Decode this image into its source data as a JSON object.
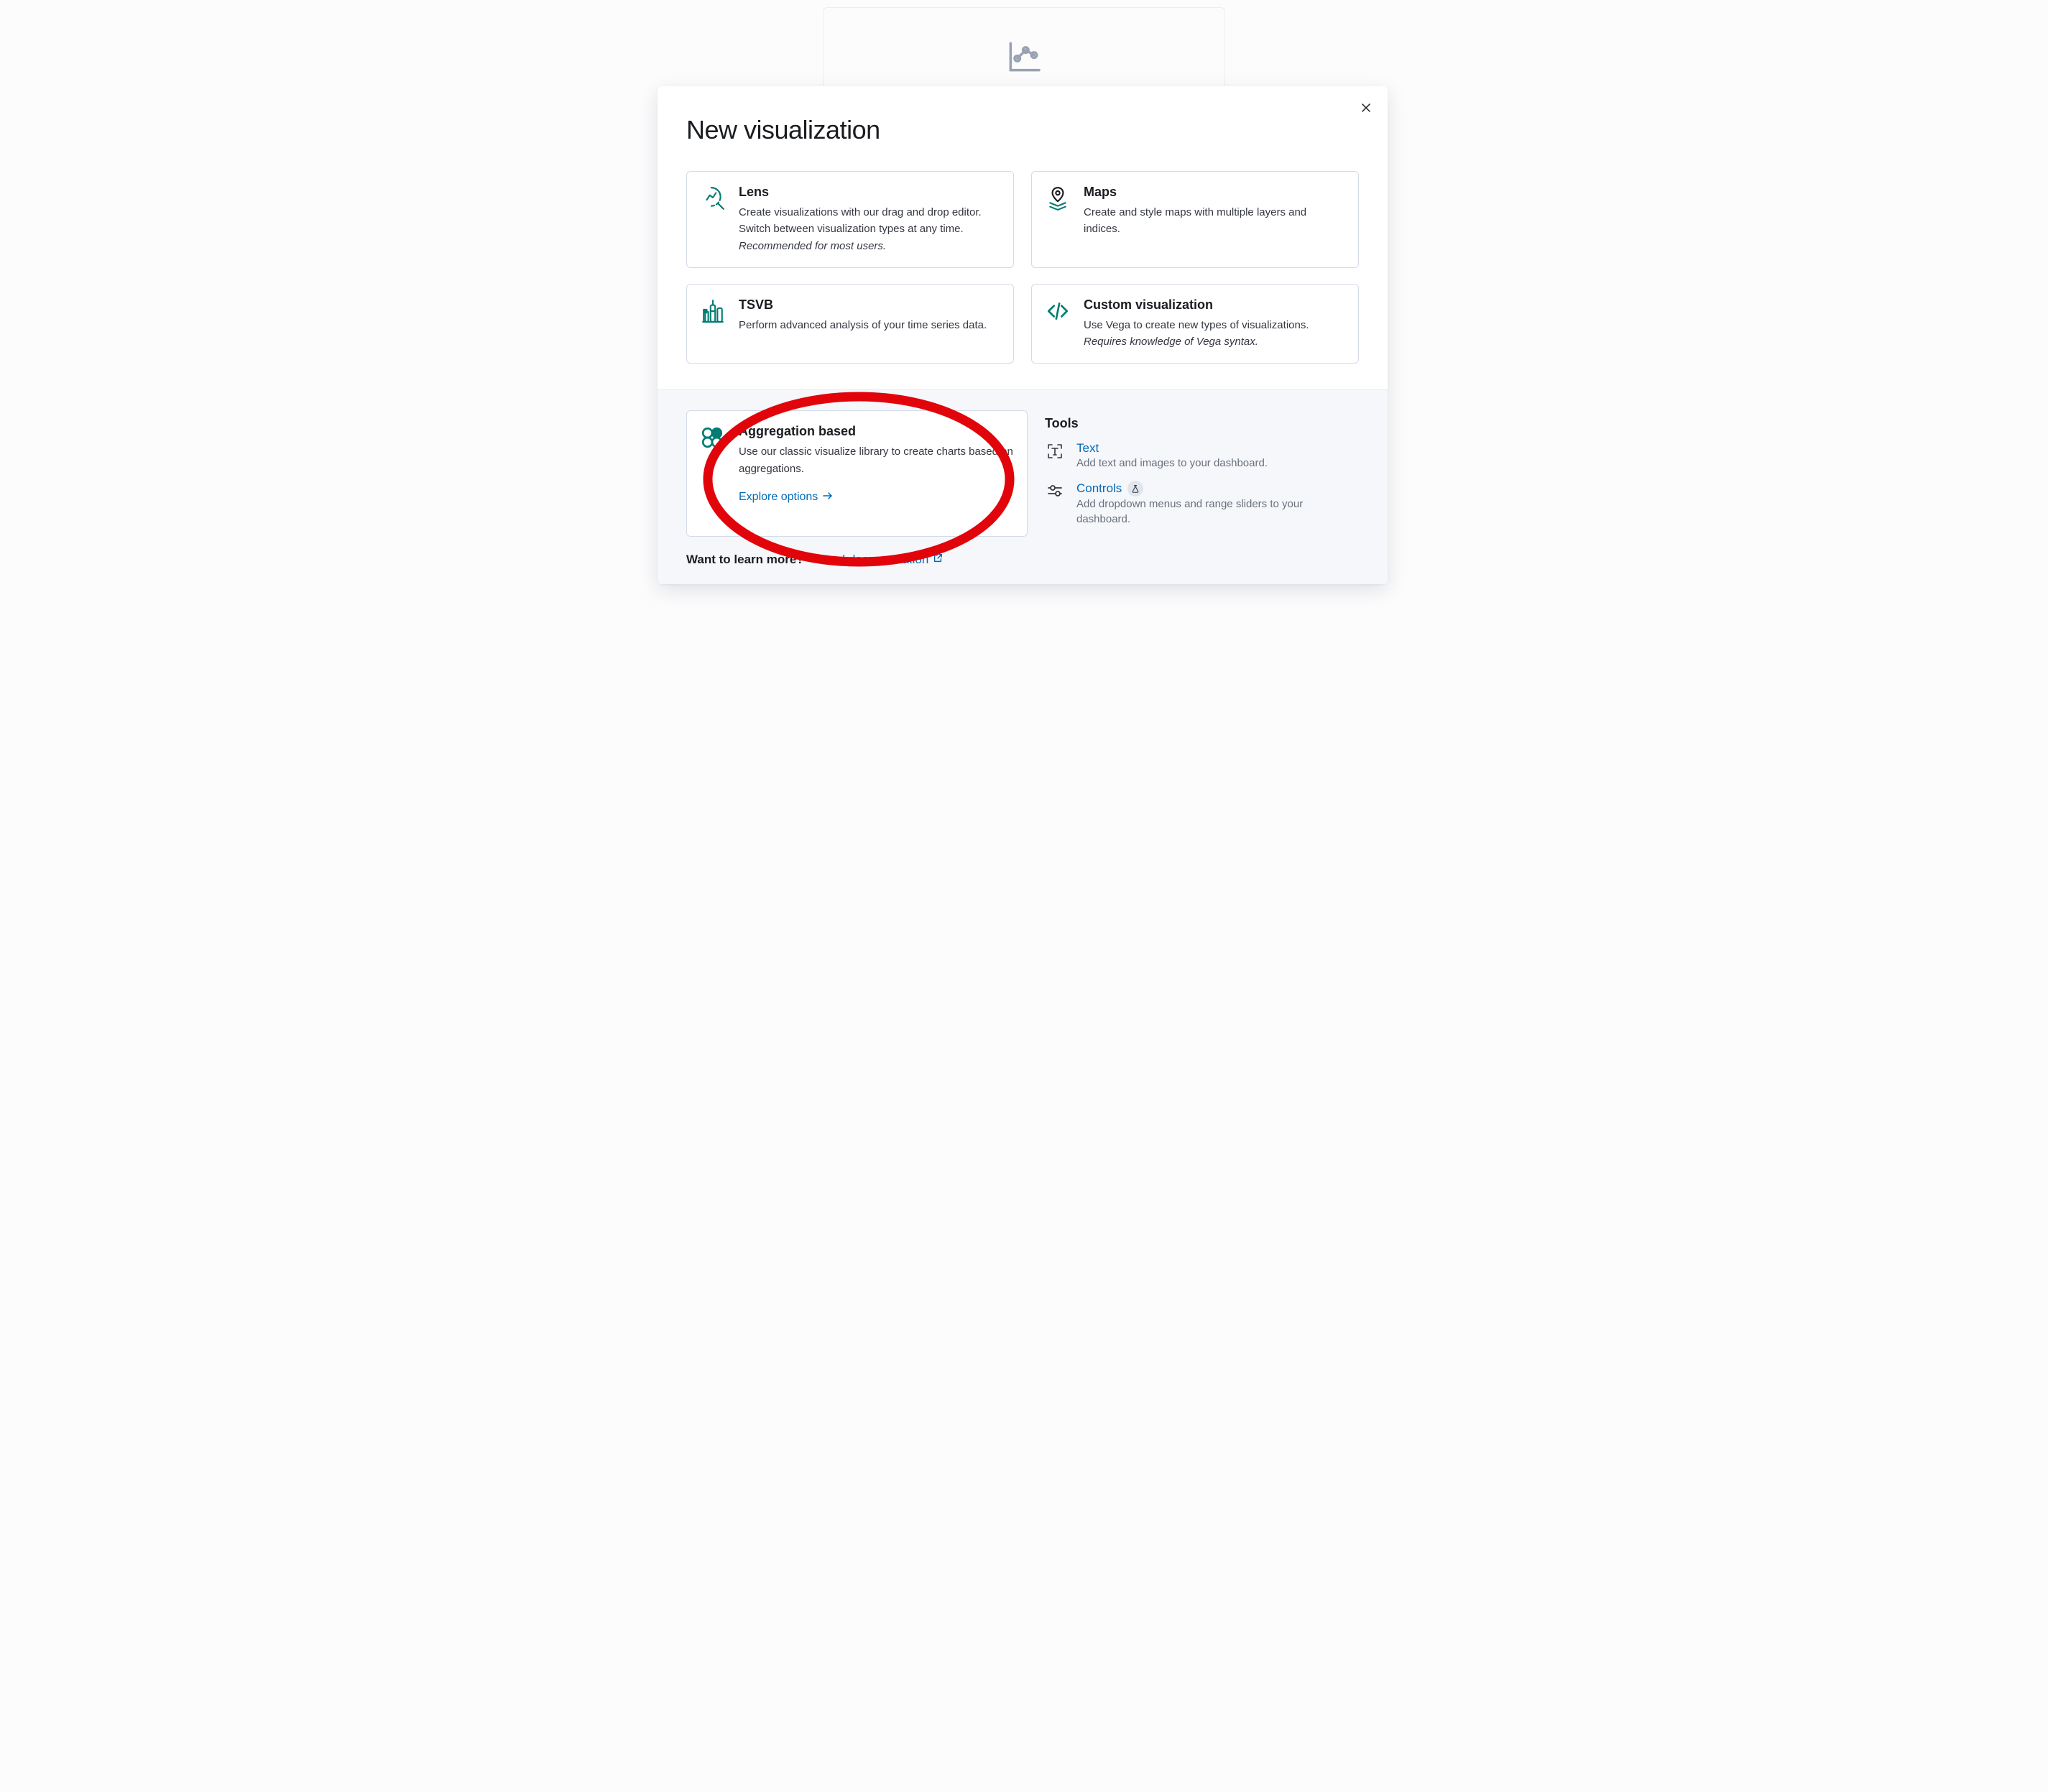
{
  "modal": {
    "title": "New visualization",
    "close_label": "Close"
  },
  "cards": {
    "lens": {
      "title": "Lens",
      "desc_a": "Create visualizations with our drag and drop editor. Switch between visualization types at any time. ",
      "desc_b": "Recommended for most users."
    },
    "maps": {
      "title": "Maps",
      "desc_a": "Create and style maps with multiple layers and indices."
    },
    "tsvb": {
      "title": "TSVB",
      "desc_a": "Perform advanced analysis of your time series data."
    },
    "custom": {
      "title": "Custom visualization",
      "desc_a": "Use Vega to create new types of visualizations. ",
      "desc_b": "Requires knowledge of Vega syntax."
    }
  },
  "agg": {
    "title": "Aggregation based",
    "desc": "Use our classic visualize library to create charts based on aggregations.",
    "explore": "Explore options"
  },
  "tools": {
    "heading": "Tools",
    "text": {
      "title": "Text",
      "desc": "Add text and images to your dashboard."
    },
    "controls": {
      "title": "Controls",
      "desc": "Add dropdown menus and range sliders to your dashboard."
    }
  },
  "learn": {
    "label": "Want to learn more?",
    "link": "Read documentation"
  },
  "colors": {
    "icon_accent": "#017d73",
    "link": "#006bb4",
    "annotation": "#e1040a"
  }
}
